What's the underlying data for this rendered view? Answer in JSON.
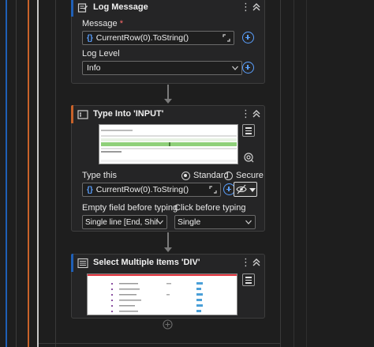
{
  "log_message": {
    "title": "Log Message",
    "message_label": "Message",
    "message_required_mark": "*",
    "message_value": "CurrentRow(0).ToString()",
    "log_level_label": "Log Level",
    "log_level_value": "Info"
  },
  "type_into": {
    "title": "Type Into 'INPUT'",
    "type_this_label": "Type this",
    "type_this_value": "CurrentRow(0).ToString()",
    "mode_options": [
      "Standard",
      "Secure"
    ],
    "mode_selected": "Standard",
    "empty_field_label": "Empty field before typing",
    "empty_field_value": "Single line [End, Shift+H",
    "click_before_label": "Click before typing",
    "click_before_value": "Single"
  },
  "select_items": {
    "title": "Select Multiple Items 'DIV'"
  },
  "colors": {
    "accent_blue": "#1f5fb6",
    "accent_orange": "#c8622a",
    "link_blue": "#5aa0ff"
  }
}
